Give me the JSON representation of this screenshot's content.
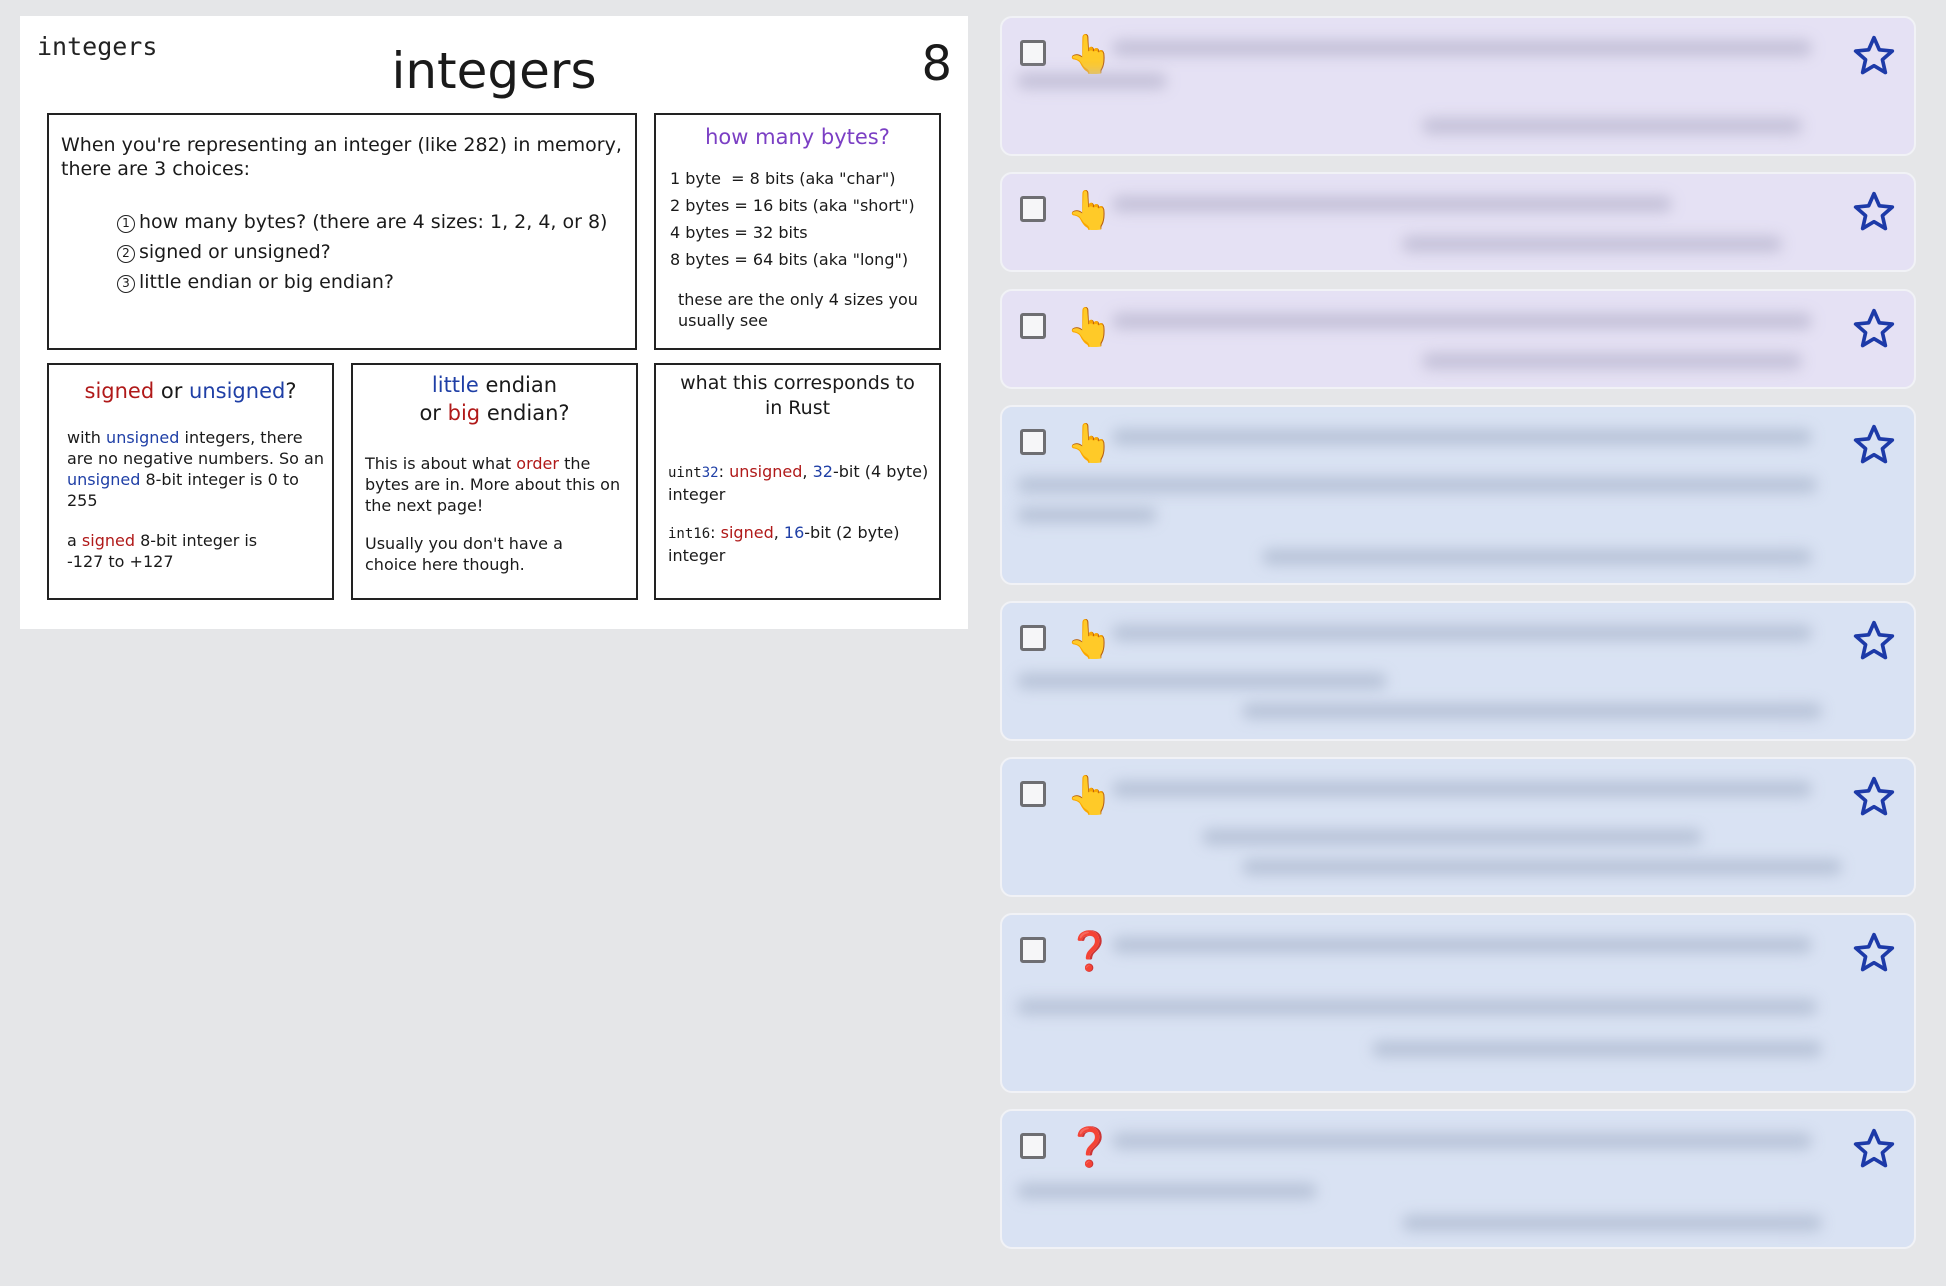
{
  "comic": {
    "label": "integers",
    "title": "integers",
    "page_number": "8",
    "intro": {
      "text": "When you're representing an integer (like 282) in memory, there are 3 choices:",
      "choices": [
        {
          "num": "1",
          "text": "how many bytes? (there are 4 sizes: 1, 2, 4, or 8)"
        },
        {
          "num": "2",
          "text": "signed or unsigned?"
        },
        {
          "num": "3",
          "text": "little endian or big endian?"
        }
      ]
    },
    "bytes": {
      "title": "how many bytes?",
      "rows": [
        "1 byte  = 8 bits (aka \"char\")",
        "2 bytes = 16 bits (aka \"short\")",
        "4 bytes = 32 bits",
        "8 bytes = 64 bits (aka \"long\")"
      ],
      "note": "these are the only 4 sizes you usually see"
    },
    "signed": {
      "title_signed": "signed",
      "title_or": "or",
      "title_unsigned": "unsigned",
      "title_q": "?",
      "p1_a": "with",
      "p1_unsigned": "unsigned",
      "p1_b": "integers, there are no negative numbers. So an",
      "p1_unsigned2": "unsigned",
      "p1_c": "8-bit integer is 0 to 255",
      "p2_a": "a",
      "p2_signed": "signed",
      "p2_b": "8-bit integer is -127 to +127"
    },
    "endian": {
      "title_little": "little",
      "title_endian1": "endian",
      "title_or": "or",
      "title_big": "big",
      "title_endian2": "endian?",
      "p1_a": "This is about what",
      "p1_order": "order",
      "p1_b": "the bytes are in. More about this on the next page!",
      "p2": "Usually you don't have a choice here though."
    },
    "rust": {
      "title": "what this corresponds to in Rust",
      "r1_type_a": "uint",
      "r1_type_b": "32",
      "r1_colon": ":",
      "r1_unsigned": "unsigned",
      "r1_comma": ",",
      "r1_bits": "32",
      "r1_rest": "-bit (4 byte) integer",
      "r2_type_a": "int16",
      "r2_colon": ":",
      "r2_signed": "signed",
      "r2_comma": ",",
      "r2_bits": "16",
      "r2_rest": "-bit (2 byte) integer"
    }
  },
  "cards": [
    {
      "emoji": "👆",
      "kind": "hand",
      "tint": "purple"
    },
    {
      "emoji": "👆",
      "kind": "hand",
      "tint": "purple"
    },
    {
      "emoji": "👆",
      "kind": "hand",
      "tint": "purple"
    },
    {
      "emoji": "👆",
      "kind": "hand",
      "tint": "blue"
    },
    {
      "emoji": "👆",
      "kind": "hand",
      "tint": "blue"
    },
    {
      "emoji": "👆",
      "kind": "hand",
      "tint": "blue"
    },
    {
      "emoji": "❓",
      "kind": "question",
      "tint": "blue"
    },
    {
      "emoji": "❓",
      "kind": "question",
      "tint": "blue"
    }
  ],
  "colors": {
    "star": "#1d3aa8",
    "card_purple": "#e5e1f4",
    "card_blue": "#d9e2f3",
    "background": "#e5e6e8"
  }
}
